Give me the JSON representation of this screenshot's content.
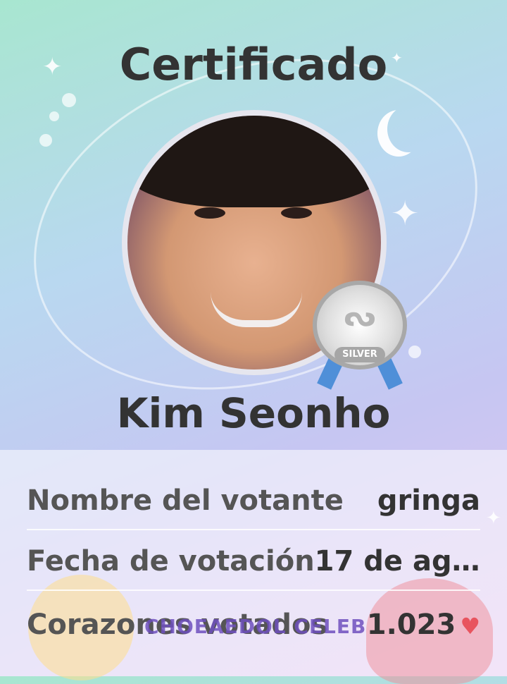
{
  "title": "Certificado",
  "celebrity_name": "Kim Seonho",
  "badge": {
    "label": "SILVER",
    "logo": "ᔓ"
  },
  "rows": [
    {
      "label": "Nombre del votante",
      "value": "gringa"
    },
    {
      "label": "Fecha de votación",
      "value": "17 de ago..."
    },
    {
      "label": "Corazones votados",
      "value": "1.023"
    }
  ],
  "watermark": "CHOEAEDOL CELEB",
  "icons": {
    "heart": "♥",
    "sparkle": "✦"
  },
  "colors": {
    "heart": "#e8545e",
    "ribbon": "#4f8fd8"
  }
}
